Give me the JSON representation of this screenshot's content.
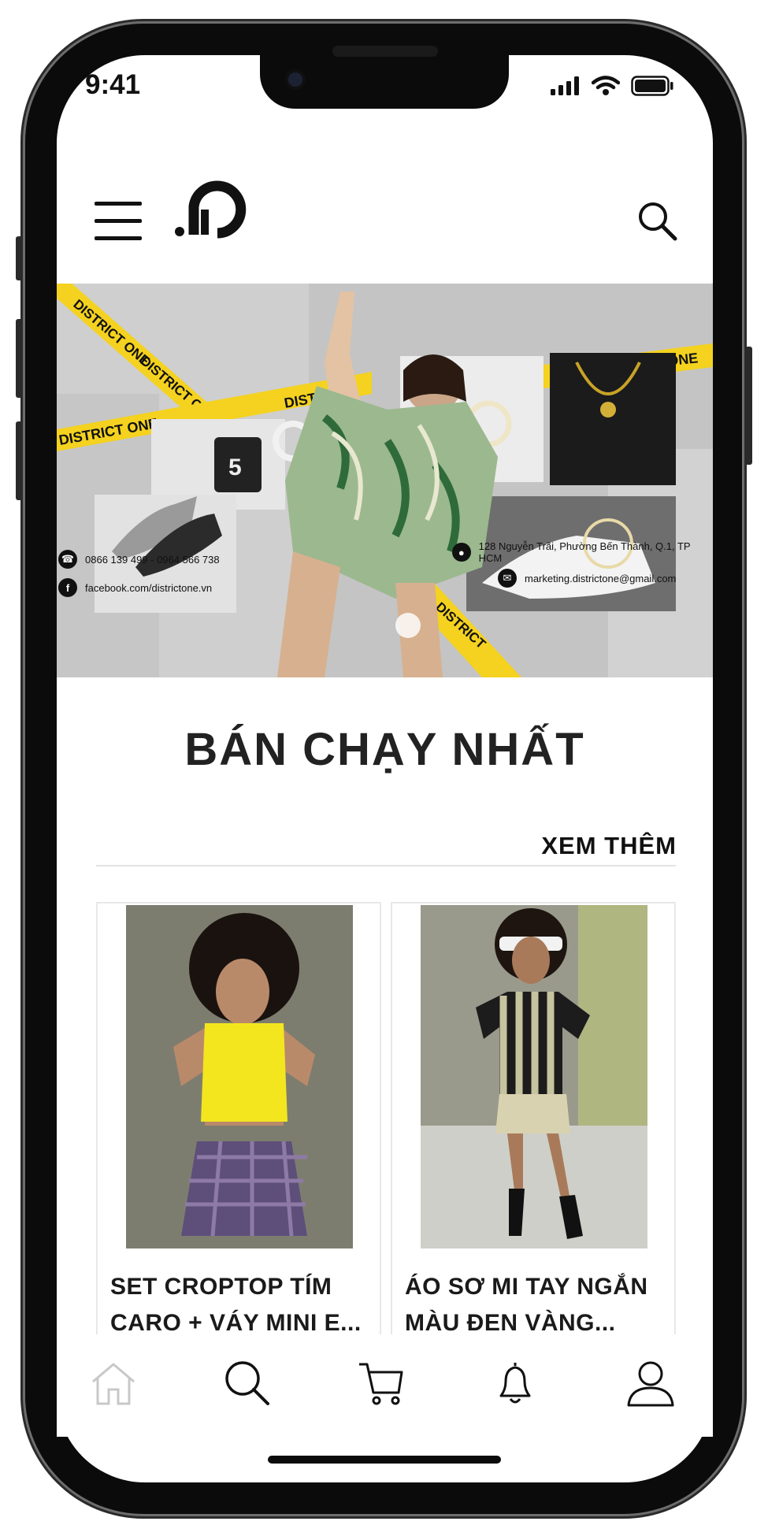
{
  "status_bar": {
    "time": "9:41"
  },
  "header": {
    "logo_text": ".D"
  },
  "banner": {
    "phone": "0866 139 499  -  0964 566 738",
    "facebook": "facebook.com/districtone.vn",
    "address": "128 Nguyễn Trãi, Phường Bến Thành, Q.1, TP HCM",
    "email": "marketing.districtone@gmail.com",
    "tape_text": "DISTRICT ONE"
  },
  "section": {
    "title": "BÁN CHẠY NHẤT",
    "see_more": "XEM THÊM"
  },
  "products": [
    {
      "name": "SET CROPTOP TÍM CARO + VÁY MINI E..."
    },
    {
      "name": "ÁO SƠ MI TAY NGẮN MÀU ĐEN VÀNG..."
    }
  ],
  "bottom_nav": {
    "items": [
      "home-icon",
      "search-icon",
      "cart-icon",
      "bell-icon",
      "user-icon"
    ],
    "active": "home"
  },
  "colors": {
    "accent_tape": "#f4d21f",
    "text": "#111111",
    "inactive_icon": "#c8c8c8"
  }
}
